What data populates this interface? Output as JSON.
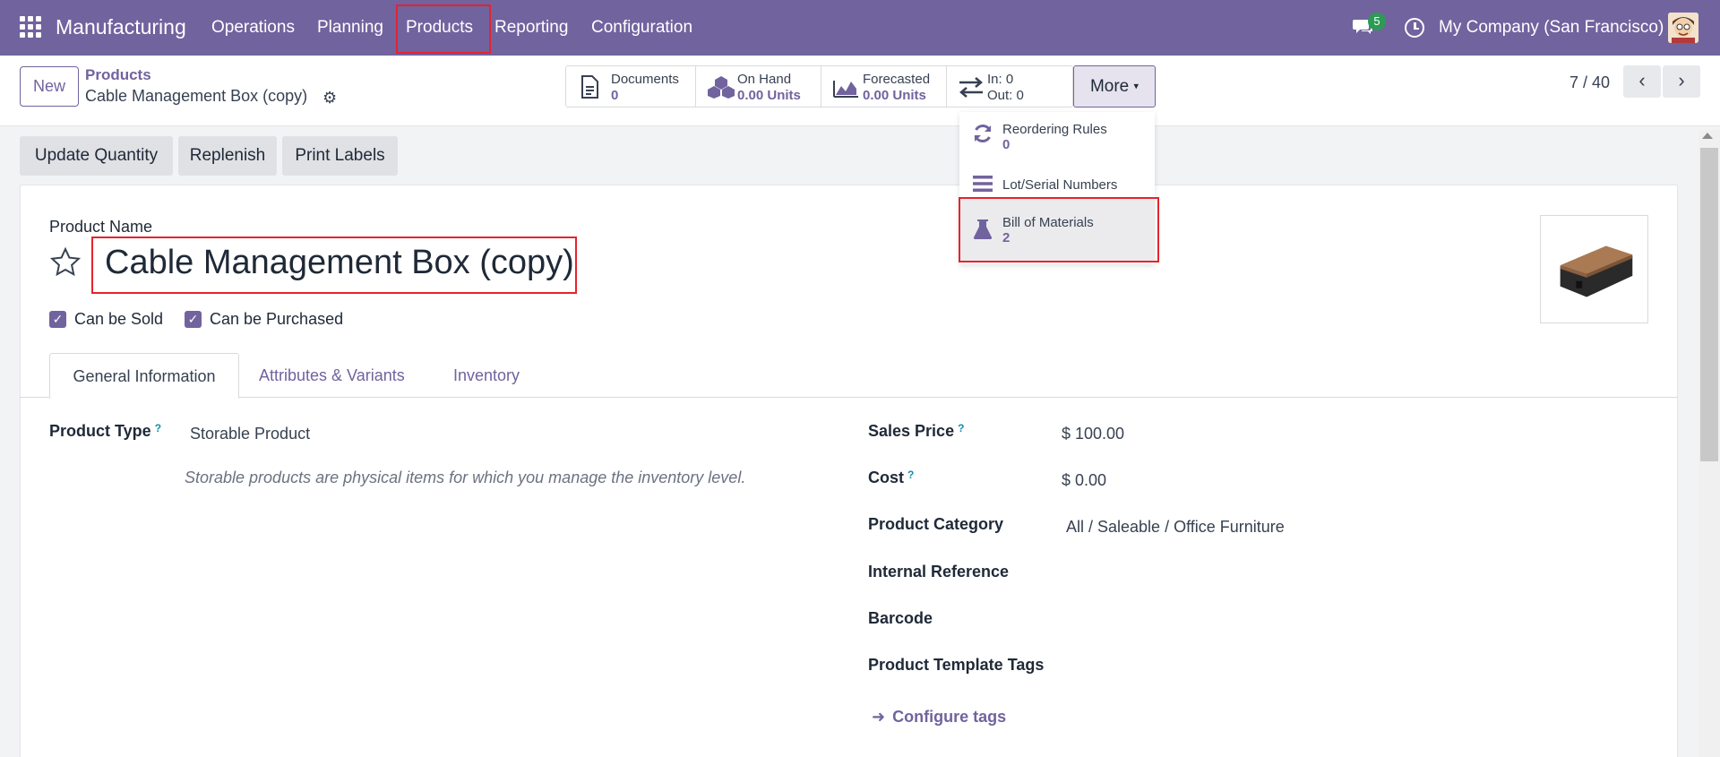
{
  "nav": {
    "brand": "Manufacturing",
    "menu": [
      "Operations",
      "Planning",
      "Products",
      "Reporting",
      "Configuration"
    ],
    "chat_badge": "5",
    "company": "My Company (San Francisco)"
  },
  "control": {
    "new_label": "New",
    "breadcrumb": "Products",
    "record_name": "Cable Management Box (copy)",
    "stats": [
      {
        "label": "Documents",
        "value": "0"
      },
      {
        "label": "On Hand",
        "value": "0.00 Units"
      },
      {
        "label": "Forecasted",
        "value": "0.00 Units"
      },
      {
        "label": "In: 0",
        "value": "Out: 0"
      }
    ],
    "more_label": "More",
    "pager": "7 / 40"
  },
  "dropdown": {
    "items": [
      {
        "label": "Reordering Rules",
        "value": "0"
      },
      {
        "label": "Lot/Serial Numbers",
        "value": ""
      },
      {
        "label": "Bill of Materials",
        "value": "2"
      }
    ]
  },
  "actions": [
    "Update Quantity",
    "Replenish",
    "Print Labels"
  ],
  "product": {
    "name_label": "Product Name",
    "name": "Cable Management Box (copy)",
    "can_be_sold": "Can be Sold",
    "can_be_purchased": "Can be Purchased"
  },
  "tabs": [
    "General Information",
    "Attributes & Variants",
    "Inventory"
  ],
  "form": {
    "product_type_label": "Product Type",
    "product_type": "Storable Product",
    "product_type_help": "Storable products are physical items for which you manage the inventory level.",
    "sales_price_label": "Sales Price",
    "sales_price": "$ 100.00",
    "cost_label": "Cost",
    "cost": "$ 0.00",
    "category_label": "Product Category",
    "category": "All / Saleable / Office Furniture",
    "internal_ref_label": "Internal Reference",
    "barcode_label": "Barcode",
    "tags_label": "Product Template Tags",
    "configure_tags": "Configure tags",
    "help_mark": "?"
  },
  "colors": {
    "brand": "#71639e",
    "highlight": "#e5232d"
  }
}
